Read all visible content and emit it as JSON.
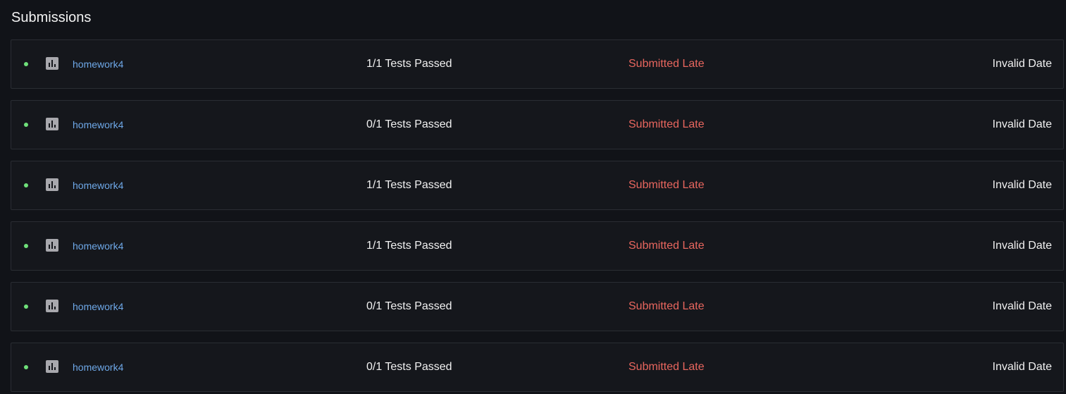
{
  "header": {
    "title": "Submissions"
  },
  "colors": {
    "background": "#111318",
    "row_background": "#15171c",
    "row_border": "#2a2d33",
    "status_dot": "#6fe07a",
    "link": "#6ea8e8",
    "late": "#e8665e",
    "icon": "#a8a8ad"
  },
  "row_icons": {
    "status": "status-dot-icon",
    "grade": "bar-chart-icon"
  },
  "submissions": [
    {
      "assignment": "homework4",
      "tests": "1/1 Tests Passed",
      "status": "Submitted Late",
      "date": "Invalid Date"
    },
    {
      "assignment": "homework4",
      "tests": "0/1 Tests Passed",
      "status": "Submitted Late",
      "date": "Invalid Date"
    },
    {
      "assignment": "homework4",
      "tests": "1/1 Tests Passed",
      "status": "Submitted Late",
      "date": "Invalid Date"
    },
    {
      "assignment": "homework4",
      "tests": "1/1 Tests Passed",
      "status": "Submitted Late",
      "date": "Invalid Date"
    },
    {
      "assignment": "homework4",
      "tests": "0/1 Tests Passed",
      "status": "Submitted Late",
      "date": "Invalid Date"
    },
    {
      "assignment": "homework4",
      "tests": "0/1 Tests Passed",
      "status": "Submitted Late",
      "date": "Invalid Date"
    }
  ]
}
